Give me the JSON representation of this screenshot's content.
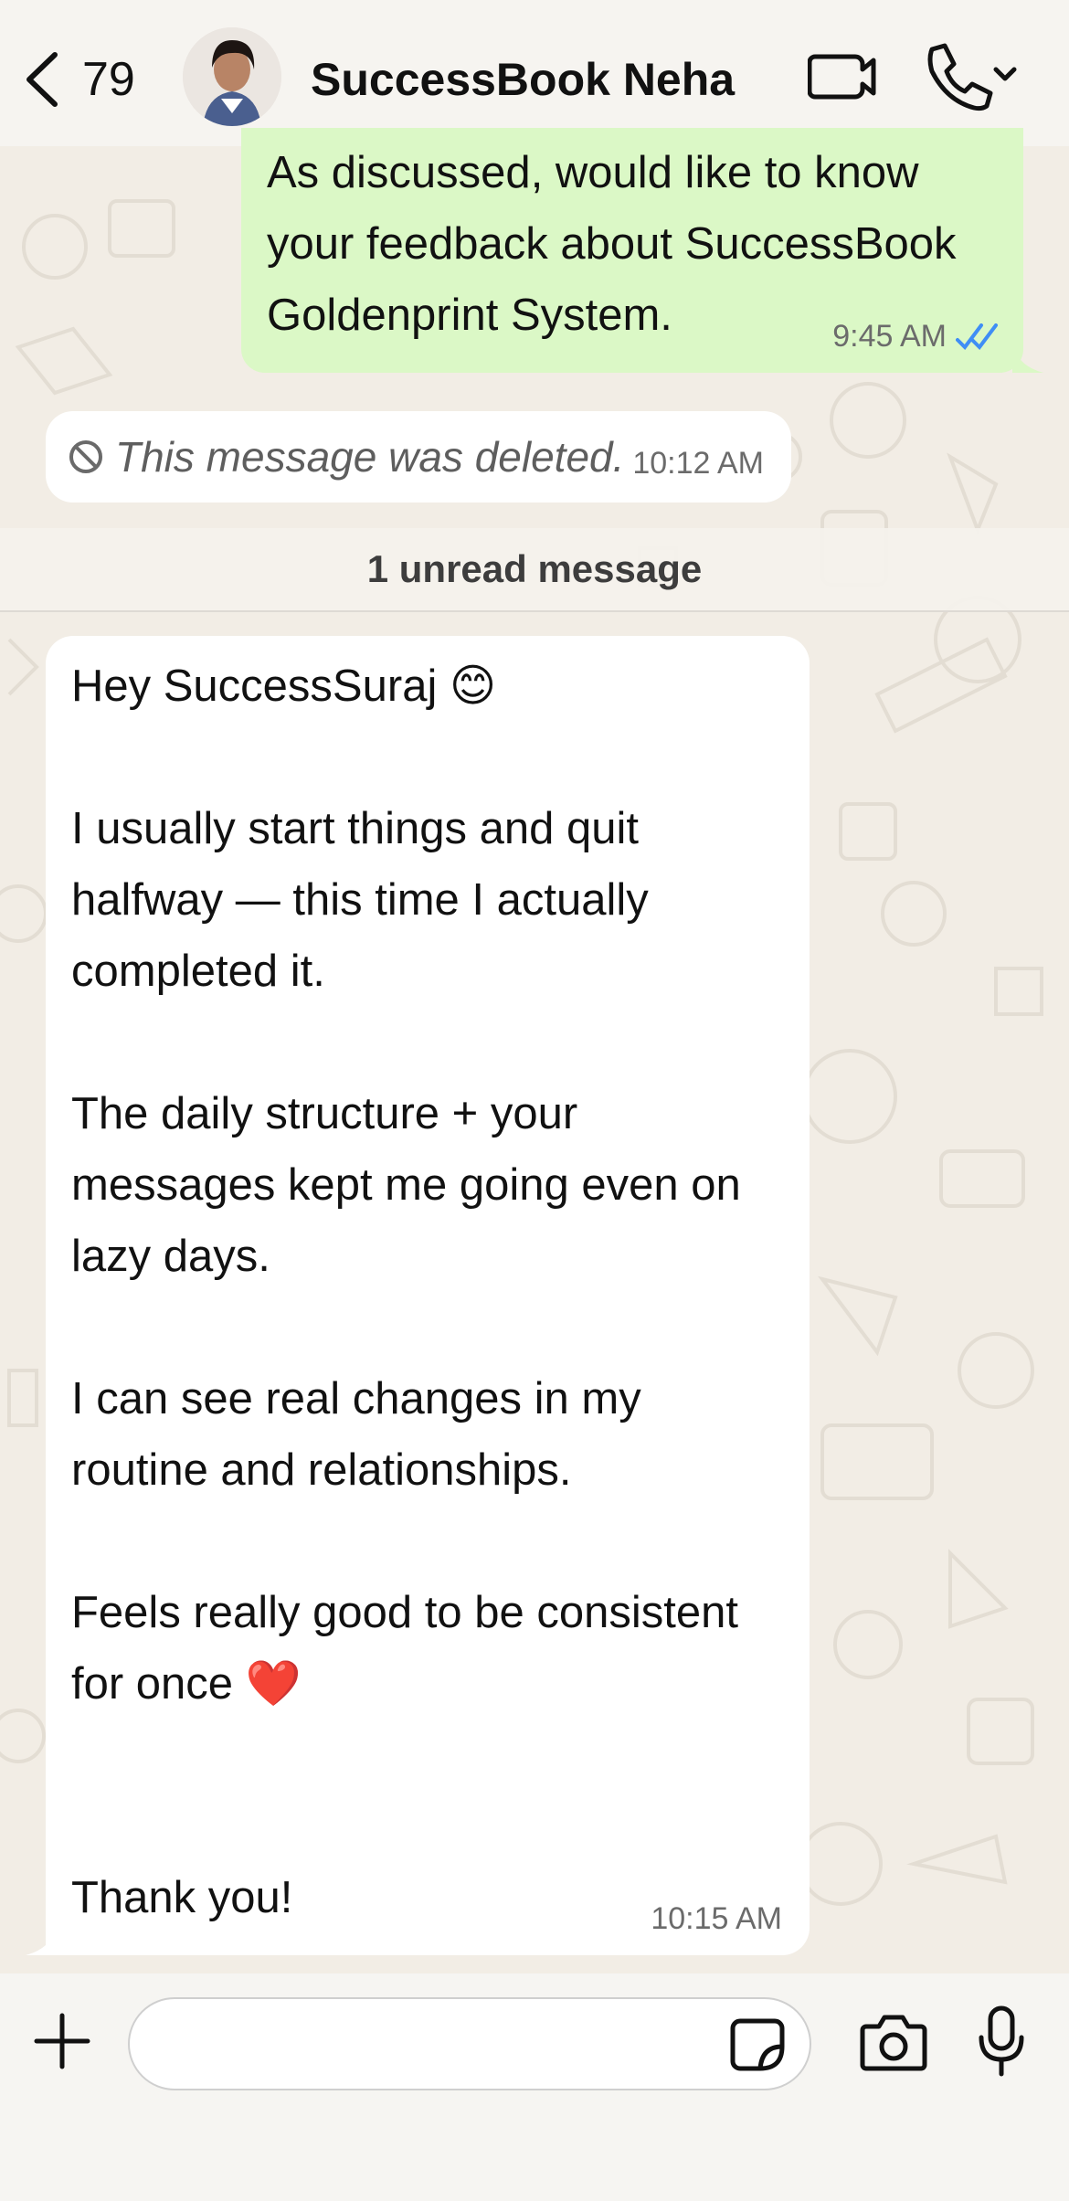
{
  "header": {
    "back_count": "79",
    "contact_name": "SuccessBook Neha",
    "icons": [
      "chevron-left-icon",
      "avatar",
      "video-call-icon",
      "phone-icon",
      "chevron-down-icon"
    ]
  },
  "messages": {
    "outgoing": {
      "text": "As discussed, would like to know\nyour feedback about SuccessBook\nGoldenprint System.",
      "time": "9:45 AM",
      "status_icon": "double-check-read-icon",
      "status_color": "#3f8ef5"
    },
    "deleted": {
      "text": "This message was deleted.",
      "time": "10:12 AM",
      "icon": "blocked-icon"
    },
    "unread_banner": "1 unread message",
    "incoming": {
      "greeting": "Hey SuccessSuraj 😊",
      "p1": "I usually start things and quit halfway — this time I actually completed it.",
      "p2": "The daily structure + your messages kept me going even on lazy days.",
      "p3": "I can see real changes in my routine and relationships.",
      "p4": "Feels really good to be consistent for once ❤️",
      "p5": "Thank you!",
      "time": "10:15 AM"
    }
  },
  "composer": {
    "placeholder": "",
    "icons": [
      "plus-icon",
      "sticker-icon",
      "camera-icon",
      "mic-icon"
    ]
  },
  "colors": {
    "outgoing_bubble": "#dbf8c6",
    "incoming_bubble": "#ffffff",
    "wallpaper": "#f2ede5"
  }
}
